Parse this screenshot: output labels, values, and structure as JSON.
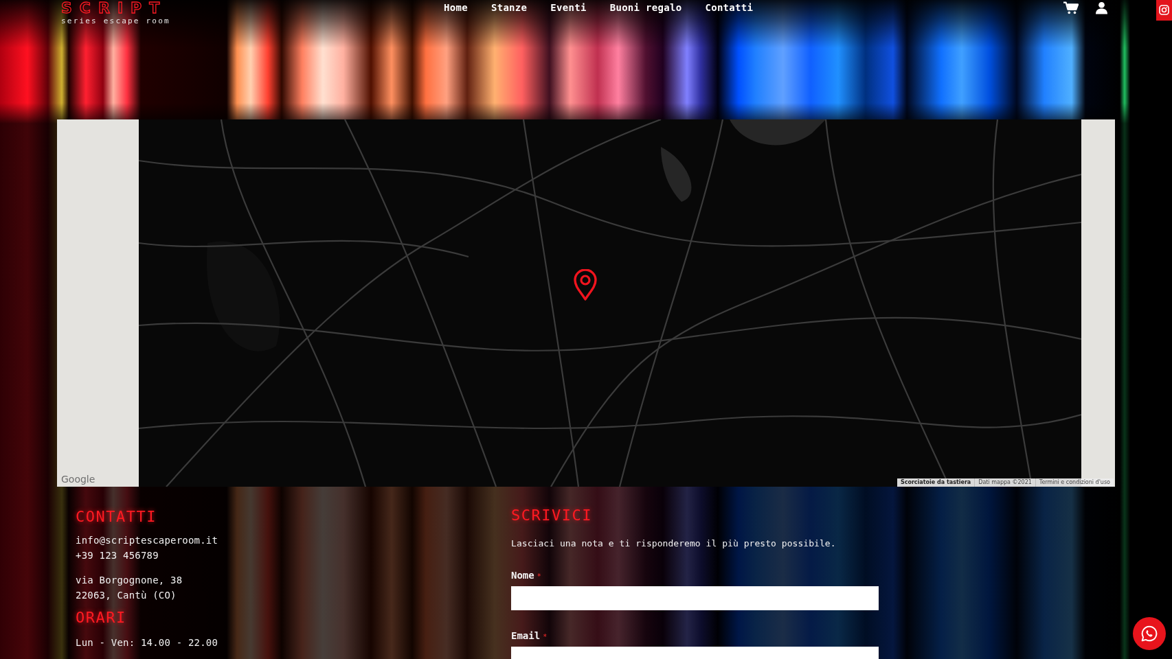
{
  "header": {
    "logo": {
      "wordmark": "SCRIPT",
      "tagline": "series escape room"
    },
    "nav": [
      "Home",
      "Stanze",
      "Eventi",
      "Buoni regalo",
      "Contatti"
    ]
  },
  "map": {
    "logo": "Google",
    "attribution": [
      "Scorciatoie da tastiera",
      "Dati mappa ©2021",
      "Termini e condizioni d'uso"
    ]
  },
  "contacts": {
    "title": "CONTATTI",
    "email": "info@scriptescaperoom.it",
    "phone": "+39 123 456789",
    "address": [
      "via Borgognone, 38",
      "22063, Cantù (CO)"
    ]
  },
  "hours": {
    "title": "ORARI",
    "lines": [
      "Lun - Ven: 14.00 - 22.00"
    ]
  },
  "form": {
    "title": "SCRIVICI",
    "intro": "Lasciaci una nota e ti risponderemo il più presto possibile.",
    "fields": [
      {
        "label": "Nome",
        "required_mark": "*"
      },
      {
        "label": "Email",
        "required_mark": "*"
      }
    ]
  }
}
